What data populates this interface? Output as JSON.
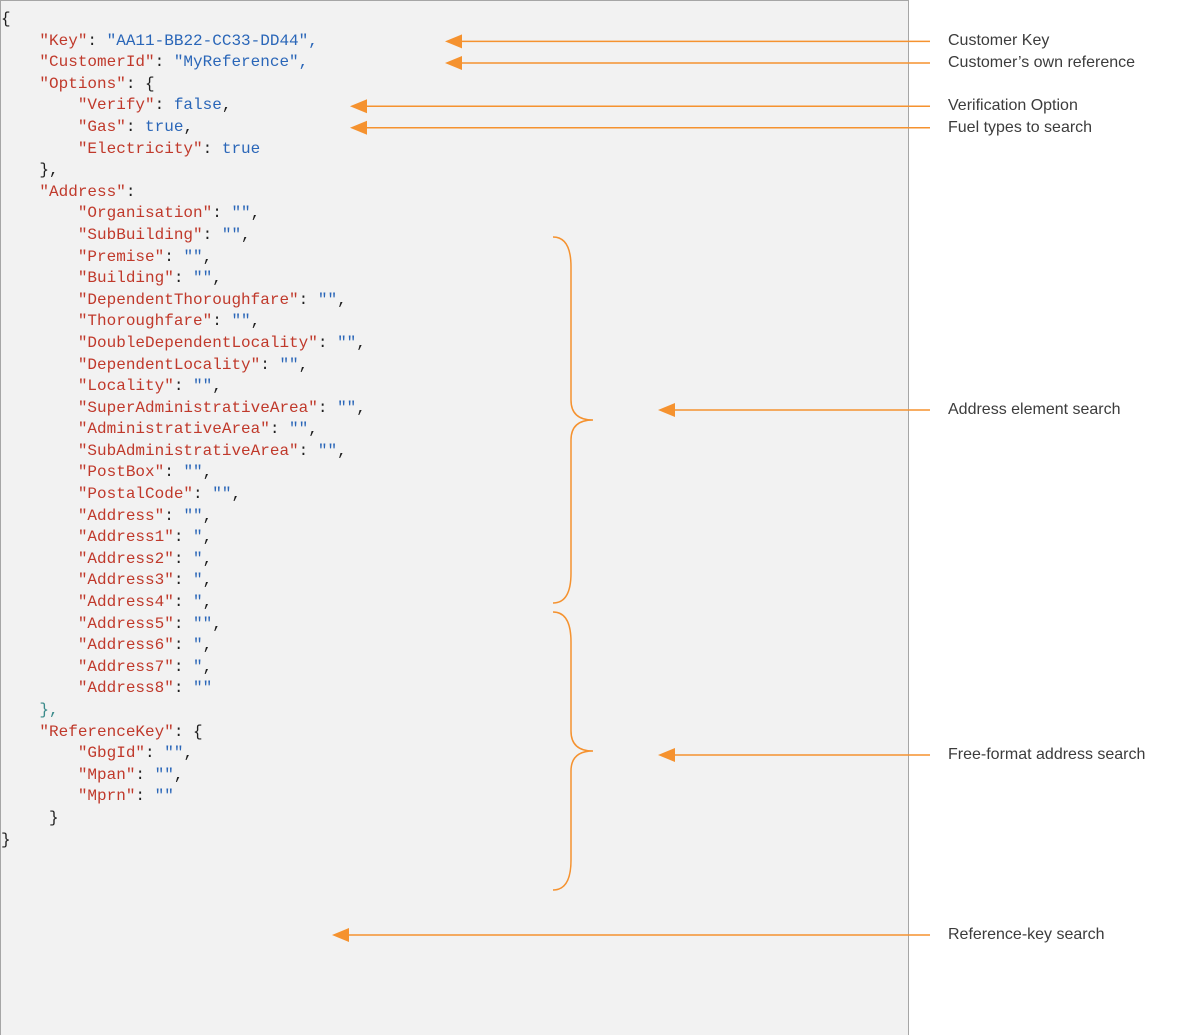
{
  "colors": {
    "accent": "#f5922f",
    "panel_background": "#f2f2f2",
    "panel_border": "#a6a6a6",
    "key_text": "#c0392b",
    "value_text": "#2a66b8",
    "punctuation": "#1e1e1e",
    "label_text": "#3c3c3c"
  },
  "code_lines": [
    [
      {
        "t": "p",
        "v": "{"
      }
    ],
    [
      {
        "t": "p",
        "v": "    "
      },
      {
        "t": "k",
        "v": "\"Key\""
      },
      {
        "t": "p",
        "v": ": "
      },
      {
        "t": "s",
        "v": "\"AA11-BB22-CC33-DD44\","
      }
    ],
    [
      {
        "t": "p",
        "v": "    "
      },
      {
        "t": "k",
        "v": "\"CustomerId\""
      },
      {
        "t": "p",
        "v": ": "
      },
      {
        "t": "s",
        "v": "\"MyReference\","
      }
    ],
    [
      {
        "t": "p",
        "v": "    "
      },
      {
        "t": "k",
        "v": "\"Options\""
      },
      {
        "t": "p",
        "v": ": {"
      }
    ],
    [
      {
        "t": "p",
        "v": "        "
      },
      {
        "t": "k",
        "v": "\"Verify\""
      },
      {
        "t": "p",
        "v": ": "
      },
      {
        "t": "v",
        "v": "false"
      },
      {
        "t": "p",
        "v": ","
      }
    ],
    [
      {
        "t": "p",
        "v": "        "
      },
      {
        "t": "k",
        "v": "\"Gas\""
      },
      {
        "t": "p",
        "v": ": "
      },
      {
        "t": "v",
        "v": "true"
      },
      {
        "t": "p",
        "v": ","
      }
    ],
    [
      {
        "t": "p",
        "v": "        "
      },
      {
        "t": "k",
        "v": "\"Electricity\""
      },
      {
        "t": "p",
        "v": ": "
      },
      {
        "t": "v",
        "v": "true"
      }
    ],
    [
      {
        "t": "p",
        "v": "    },"
      }
    ],
    [
      {
        "t": "p",
        "v": "    "
      },
      {
        "t": "k",
        "v": "\"Address\""
      },
      {
        "t": "p",
        "v": ":"
      }
    ],
    [
      {
        "t": "p",
        "v": "        "
      },
      {
        "t": "k",
        "v": "\"Organisation\""
      },
      {
        "t": "p",
        "v": ": "
      },
      {
        "t": "q",
        "v": "\"\""
      },
      {
        "t": "p",
        "v": ","
      }
    ],
    [
      {
        "t": "p",
        "v": "        "
      },
      {
        "t": "k",
        "v": "\"SubBuilding\""
      },
      {
        "t": "p",
        "v": ": "
      },
      {
        "t": "q",
        "v": "\"\""
      },
      {
        "t": "p",
        "v": ","
      }
    ],
    [
      {
        "t": "p",
        "v": "        "
      },
      {
        "t": "k",
        "v": "\"Premise\""
      },
      {
        "t": "p",
        "v": ": "
      },
      {
        "t": "q",
        "v": "\"\""
      },
      {
        "t": "p",
        "v": ","
      }
    ],
    [
      {
        "t": "p",
        "v": "        "
      },
      {
        "t": "k",
        "v": "\"Building\""
      },
      {
        "t": "p",
        "v": ": "
      },
      {
        "t": "q",
        "v": "\"\""
      },
      {
        "t": "p",
        "v": ","
      }
    ],
    [
      {
        "t": "p",
        "v": "        "
      },
      {
        "t": "k",
        "v": "\"DependentThoroughfare\""
      },
      {
        "t": "p",
        "v": ": "
      },
      {
        "t": "q",
        "v": "\"\""
      },
      {
        "t": "p",
        "v": ","
      }
    ],
    [
      {
        "t": "p",
        "v": "        "
      },
      {
        "t": "k",
        "v": "\"Thoroughfare\""
      },
      {
        "t": "p",
        "v": ": "
      },
      {
        "t": "q",
        "v": "\"\""
      },
      {
        "t": "p",
        "v": ","
      }
    ],
    [
      {
        "t": "p",
        "v": "        "
      },
      {
        "t": "k",
        "v": "\"DoubleDependentLocality\""
      },
      {
        "t": "p",
        "v": ": "
      },
      {
        "t": "q",
        "v": "\"\""
      },
      {
        "t": "p",
        "v": ","
      }
    ],
    [
      {
        "t": "p",
        "v": "        "
      },
      {
        "t": "k",
        "v": "\"DependentLocality\""
      },
      {
        "t": "p",
        "v": ": "
      },
      {
        "t": "q",
        "v": "\"\""
      },
      {
        "t": "p",
        "v": ","
      }
    ],
    [
      {
        "t": "p",
        "v": "        "
      },
      {
        "t": "k",
        "v": "\"Locality\""
      },
      {
        "t": "p",
        "v": ": "
      },
      {
        "t": "q",
        "v": "\"\""
      },
      {
        "t": "p",
        "v": ","
      }
    ],
    [
      {
        "t": "p",
        "v": "        "
      },
      {
        "t": "k",
        "v": "\"SuperAdministrativeArea\""
      },
      {
        "t": "p",
        "v": ": "
      },
      {
        "t": "q",
        "v": "\"\""
      },
      {
        "t": "p",
        "v": ","
      }
    ],
    [
      {
        "t": "p",
        "v": "        "
      },
      {
        "t": "k",
        "v": "\"AdministrativeArea\""
      },
      {
        "t": "p",
        "v": ": "
      },
      {
        "t": "q",
        "v": "\"\""
      },
      {
        "t": "p",
        "v": ","
      }
    ],
    [
      {
        "t": "p",
        "v": "        "
      },
      {
        "t": "k",
        "v": "\"SubAdministrativeArea\""
      },
      {
        "t": "p",
        "v": ": "
      },
      {
        "t": "q",
        "v": "\"\""
      },
      {
        "t": "p",
        "v": ","
      }
    ],
    [
      {
        "t": "p",
        "v": "        "
      },
      {
        "t": "k",
        "v": "\"PostBox\""
      },
      {
        "t": "p",
        "v": ": "
      },
      {
        "t": "q",
        "v": "\"\""
      },
      {
        "t": "p",
        "v": ","
      }
    ],
    [
      {
        "t": "p",
        "v": "        "
      },
      {
        "t": "k",
        "v": "\"PostalCode\""
      },
      {
        "t": "p",
        "v": ": "
      },
      {
        "t": "q",
        "v": "\"\""
      },
      {
        "t": "p",
        "v": ","
      }
    ],
    [
      {
        "t": "p",
        "v": "        "
      },
      {
        "t": "k",
        "v": "\"Address\""
      },
      {
        "t": "p",
        "v": ": "
      },
      {
        "t": "q",
        "v": "\"\""
      },
      {
        "t": "p",
        "v": ","
      }
    ],
    [
      {
        "t": "p",
        "v": "        "
      },
      {
        "t": "k",
        "v": "\"Address1\""
      },
      {
        "t": "p",
        "v": ": "
      },
      {
        "t": "q",
        "v": "\""
      },
      {
        "t": "p",
        "v": ","
      }
    ],
    [
      {
        "t": "p",
        "v": "        "
      },
      {
        "t": "k",
        "v": "\"Address2\""
      },
      {
        "t": "p",
        "v": ": "
      },
      {
        "t": "q",
        "v": "\""
      },
      {
        "t": "p",
        "v": ","
      }
    ],
    [
      {
        "t": "p",
        "v": "        "
      },
      {
        "t": "k",
        "v": "\"Address3\""
      },
      {
        "t": "p",
        "v": ": "
      },
      {
        "t": "q",
        "v": "\""
      },
      {
        "t": "p",
        "v": ","
      }
    ],
    [
      {
        "t": "p",
        "v": "        "
      },
      {
        "t": "k",
        "v": "\"Address4\""
      },
      {
        "t": "p",
        "v": ": "
      },
      {
        "t": "q",
        "v": "\""
      },
      {
        "t": "p",
        "v": ","
      }
    ],
    [
      {
        "t": "p",
        "v": "        "
      },
      {
        "t": "k",
        "v": "\"Address5\""
      },
      {
        "t": "p",
        "v": ": "
      },
      {
        "t": "q",
        "v": "\"\""
      },
      {
        "t": "p",
        "v": ","
      }
    ],
    [
      {
        "t": "p",
        "v": "        "
      },
      {
        "t": "k",
        "v": "\"Address6\""
      },
      {
        "t": "p",
        "v": ": "
      },
      {
        "t": "q",
        "v": "\""
      },
      {
        "t": "p",
        "v": ","
      }
    ],
    [
      {
        "t": "p",
        "v": "        "
      },
      {
        "t": "k",
        "v": "\"Address7\""
      },
      {
        "t": "p",
        "v": ": "
      },
      {
        "t": "q",
        "v": "\""
      },
      {
        "t": "p",
        "v": ","
      }
    ],
    [
      {
        "t": "p",
        "v": "        "
      },
      {
        "t": "k",
        "v": "\"Address8\""
      },
      {
        "t": "p",
        "v": ": "
      },
      {
        "t": "q",
        "v": "\"\""
      }
    ],
    [
      {
        "t": "p",
        "v": "    "
      },
      {
        "t": "p2",
        "v": "},"
      }
    ],
    [
      {
        "t": "p",
        "v": "    "
      },
      {
        "t": "k",
        "v": "\"ReferenceKey\""
      },
      {
        "t": "p",
        "v": ": {"
      }
    ],
    [
      {
        "t": "p",
        "v": "        "
      },
      {
        "t": "k",
        "v": "\"GbgId\""
      },
      {
        "t": "p",
        "v": ": "
      },
      {
        "t": "q",
        "v": "\"\""
      },
      {
        "t": "p",
        "v": ","
      }
    ],
    [
      {
        "t": "p",
        "v": "        "
      },
      {
        "t": "k",
        "v": "\"Mpan\""
      },
      {
        "t": "p",
        "v": ": "
      },
      {
        "t": "q",
        "v": "\"\""
      },
      {
        "t": "p",
        "v": ","
      }
    ],
    [
      {
        "t": "p",
        "v": "        "
      },
      {
        "t": "k",
        "v": "\"Mprn\""
      },
      {
        "t": "p",
        "v": ": "
      },
      {
        "t": "q",
        "v": "\"\""
      }
    ],
    [
      {
        "t": "p",
        "v": "     }"
      }
    ],
    [
      {
        "t": "p",
        "v": "}"
      }
    ]
  ],
  "annotations": [
    {
      "label": "Customer Key",
      "line": 1
    },
    {
      "label": "Customer’s own reference",
      "line": 2
    },
    {
      "label": "Verification Option",
      "line": 4
    },
    {
      "label": "Fuel types to search",
      "line": 5
    },
    {
      "label": "Address element search",
      "line": 15
    },
    {
      "label": "Free-format address search",
      "line": 27
    },
    {
      "label": "Reference-key search",
      "line": 35
    }
  ],
  "brace_groups": [
    {
      "name": "address-element-brace",
      "first_line": 9,
      "last_line": 22
    },
    {
      "name": "free-format-address-brace",
      "first_line": 23,
      "last_line": 32
    }
  ]
}
